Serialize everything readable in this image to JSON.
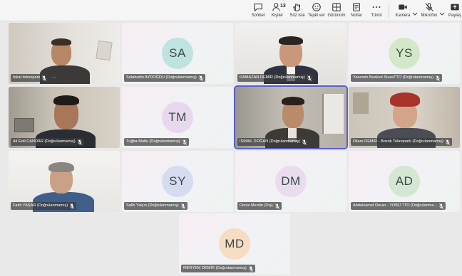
{
  "toolbar": {
    "chat": "Sohbet",
    "people": "Kişiler",
    "people_count": "13",
    "raise_hand": "Söz iste",
    "react": "Tepki ver",
    "view": "Görünüm",
    "notes": "Notlar",
    "more": "Tümü",
    "camera": "Kamera",
    "mic": "Mikrofon",
    "share": "Paylaş"
  },
  "participants": [
    {
      "name": "tokat teknopark",
      "type": "video"
    },
    {
      "name": "Selahattin AYDOĞDU (Doğrulanmamış)",
      "type": "avatar",
      "initials": "SA",
      "color": "#bfe3e0"
    },
    {
      "name": "RAMAZAN DEMİR (Doğrulanmamış)",
      "type": "video"
    },
    {
      "name": "Yasemin Bozkurt SivasTTO (Doğrulanmamış)",
      "type": "avatar",
      "initials": "YS",
      "color": "#d3e8c9"
    },
    {
      "name": "Ali Erdi CANDAR (Doğrulanmamış)",
      "type": "video"
    },
    {
      "name": "Tuğba Mutlu (Doğrulanmamış)",
      "type": "avatar",
      "initials": "TM",
      "color": "#e7d8ee"
    },
    {
      "name": "İSMAİL DOĞAN (Doğrulanmamış)",
      "type": "video"
    },
    {
      "name": "Dilara DEMİR - Bozok Teknopark (Doğrulanmamış)",
      "type": "video"
    },
    {
      "name": "Fatih YAŞAR (Doğrulanmamış)",
      "type": "video"
    },
    {
      "name": "Salih Yalçın (Doğrulanmamış)",
      "type": "avatar",
      "initials": "SY",
      "color": "#d5dcf0"
    },
    {
      "name": "Deniz Merdin (Dış)",
      "type": "avatar",
      "initials": "DM",
      "color": "#e9dcee"
    },
    {
      "name": "Abdulsamet Duran - YOBÜ TTO (Doğrulanma...",
      "type": "avatar",
      "initials": "AD",
      "color": "#d3e7d2"
    },
    {
      "name": "MERYEM DEMİR (Doğrulanmamış)",
      "type": "avatar",
      "initials": "MD",
      "color": "#f6dcc3"
    }
  ]
}
